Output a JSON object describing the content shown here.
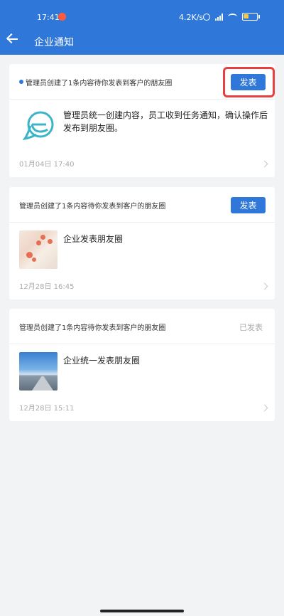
{
  "status_bar": {
    "time": "17:41",
    "net_speed": "4.2K/s",
    "battery_level": 0.4
  },
  "header": {
    "back_icon": "back-arrow-icon",
    "title": "企业通知"
  },
  "notifications": [
    {
      "header_text": "管理员创建了1条内容待你发表到客户的朋友圈",
      "unread": true,
      "action_label": "发表",
      "highlighted": true,
      "body_title": "管理员统一创建内容，员工收到任务通知，确认操作后发布到朋友圈。",
      "thumbnail": "chat-bubble-logo",
      "date": "01月04日 17:40"
    },
    {
      "header_text": "管理员创建了1条内容待你发表到客户的朋友圈",
      "action_label": "发表",
      "body_title": "企业发表朋友圈",
      "thumbnail": "flower-painting",
      "date": "12月28日 16:45"
    },
    {
      "header_text": "管理员创建了1条内容待你发表到客户的朋友圈",
      "status_label": "已发表",
      "body_title": "企业统一发表朋友圈",
      "thumbnail": "road-sky-photo",
      "date": "12月28日 15:11"
    }
  ],
  "colors": {
    "primary": "#2f78d9",
    "highlight": "#e84040",
    "background": "#f2f3f5"
  }
}
